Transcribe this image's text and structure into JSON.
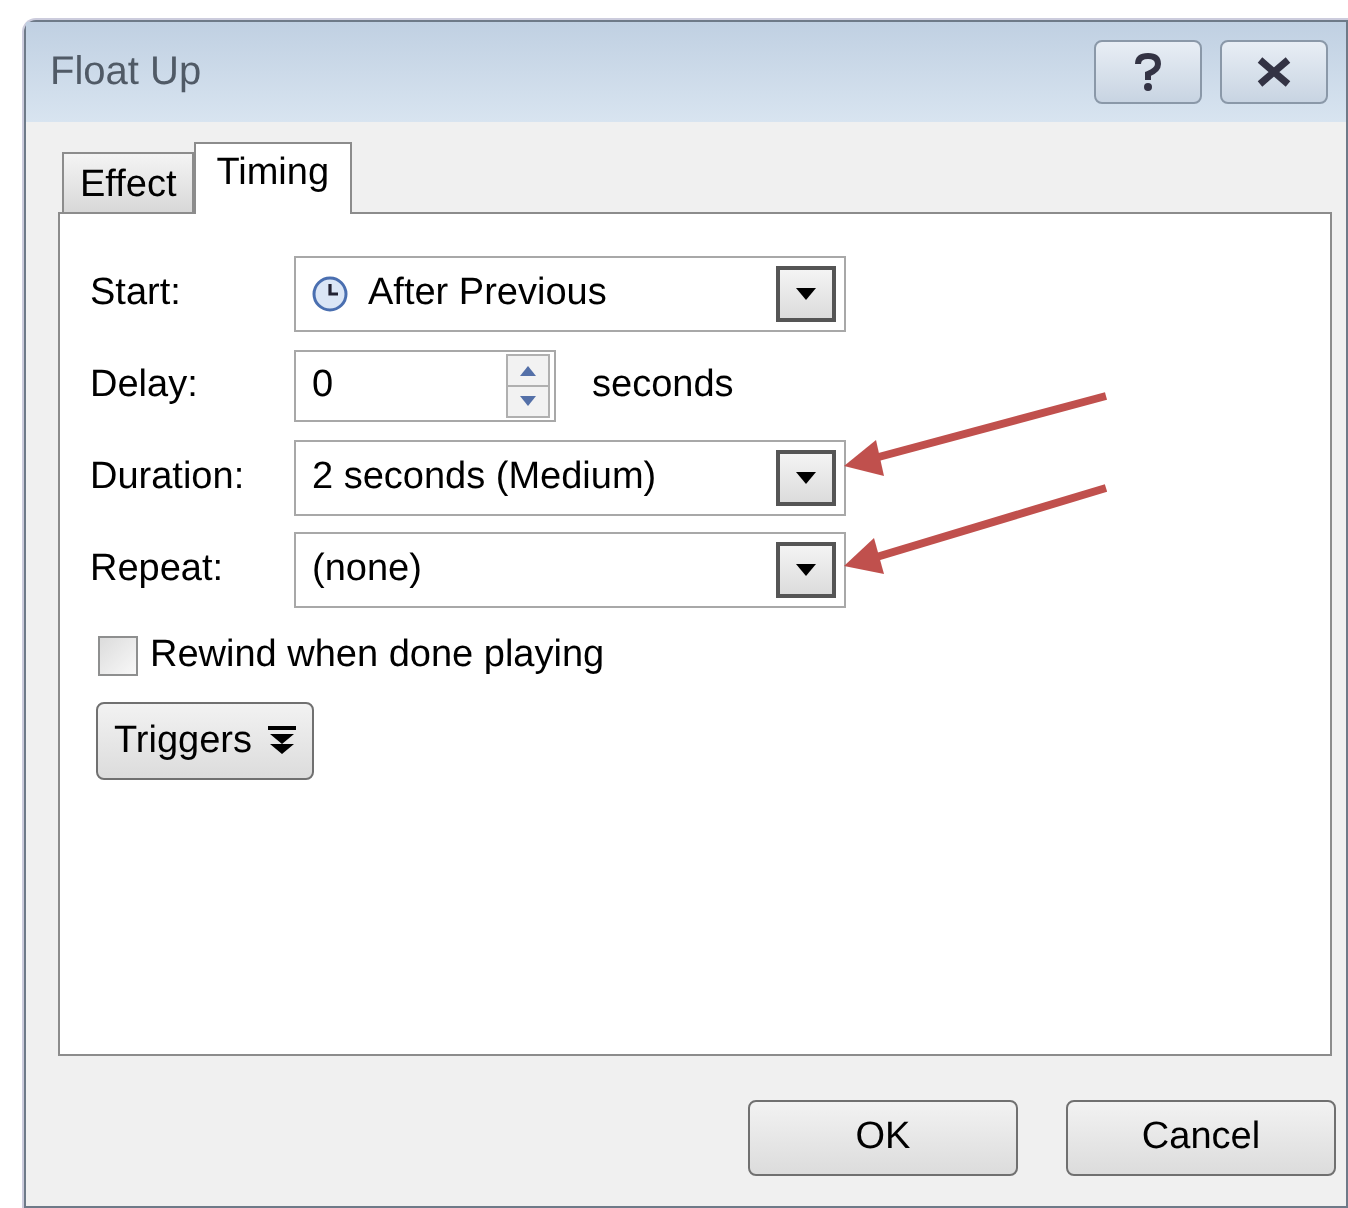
{
  "window": {
    "title": "Float Up"
  },
  "tabs": [
    {
      "label": "Effect",
      "selected": false
    },
    {
      "label": "Timing",
      "selected": true
    }
  ],
  "fields": [
    {
      "kind": "dropdown",
      "label": "Start:",
      "value": "After Previous",
      "with_icon": true
    },
    {
      "kind": "spinner",
      "label": "Delay:",
      "value": "0",
      "unit": "seconds"
    },
    {
      "kind": "dropdown",
      "label": "Duration:",
      "value": "2 seconds (Medium)",
      "with_icon": false
    },
    {
      "kind": "dropdown",
      "label": "Repeat:",
      "value": "(none)",
      "with_icon": false
    }
  ],
  "checkbox": {
    "label": "Rewind when done playing",
    "checked": false
  },
  "triggers": {
    "label": "Triggers"
  },
  "buttons": [
    "OK",
    "Cancel"
  ]
}
